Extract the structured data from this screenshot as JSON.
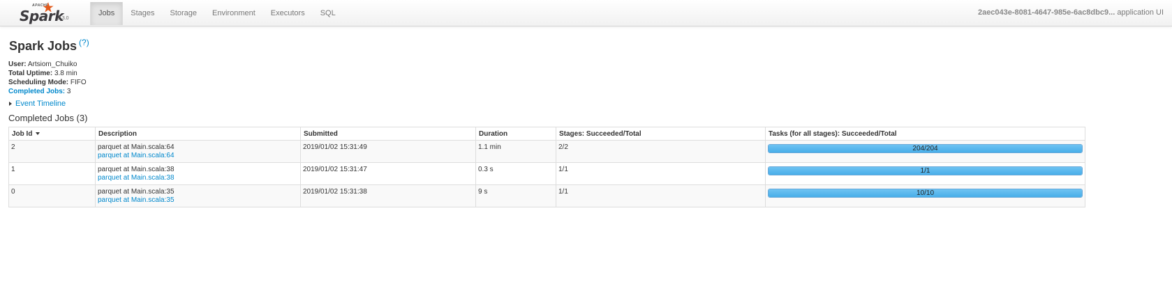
{
  "brand": {
    "apache": "APACHE",
    "name": "Spark",
    "version": "2.3.0"
  },
  "nav": {
    "items": [
      {
        "label": "Jobs",
        "active": true
      },
      {
        "label": "Stages"
      },
      {
        "label": "Storage"
      },
      {
        "label": "Environment"
      },
      {
        "label": "Executors"
      },
      {
        "label": "SQL"
      }
    ],
    "app_id": "2aec043e-8081-4647-985e-6ac8dbc9...",
    "app_suffix": "application UI"
  },
  "page": {
    "title": "Spark Jobs",
    "help": "(?)"
  },
  "summary": {
    "user_label": "User:",
    "user": "Artsiom_Chuiko",
    "uptime_label": "Total Uptime:",
    "uptime": "3.8 min",
    "scheduling_label": "Scheduling Mode:",
    "scheduling": "FIFO",
    "completed_label": "Completed Jobs:",
    "completed": "3"
  },
  "timeline": {
    "label": "Event Timeline"
  },
  "completed_jobs": {
    "title": "Completed Jobs (3)",
    "columns": {
      "job_id": "Job Id",
      "description": "Description",
      "submitted": "Submitted",
      "duration": "Duration",
      "stages": "Stages: Succeeded/Total",
      "tasks": "Tasks (for all stages): Succeeded/Total"
    },
    "rows": [
      {
        "job_id": "2",
        "description": "parquet at Main.scala:64",
        "link": "parquet at Main.scala:64",
        "submitted": "2019/01/02 15:31:49",
        "duration": "1.1 min",
        "stages": "2/2",
        "tasks": "204/204",
        "task_progress": 1.0
      },
      {
        "job_id": "1",
        "description": "parquet at Main.scala:38",
        "link": "parquet at Main.scala:38",
        "submitted": "2019/01/02 15:31:47",
        "duration": "0.3 s",
        "stages": "1/1",
        "tasks": "1/1",
        "task_progress": 1.0
      },
      {
        "job_id": "0",
        "description": "parquet at Main.scala:35",
        "link": "parquet at Main.scala:35",
        "submitted": "2019/01/02 15:31:38",
        "duration": "9 s",
        "stages": "1/1",
        "tasks": "10/10",
        "task_progress": 1.0
      }
    ]
  }
}
